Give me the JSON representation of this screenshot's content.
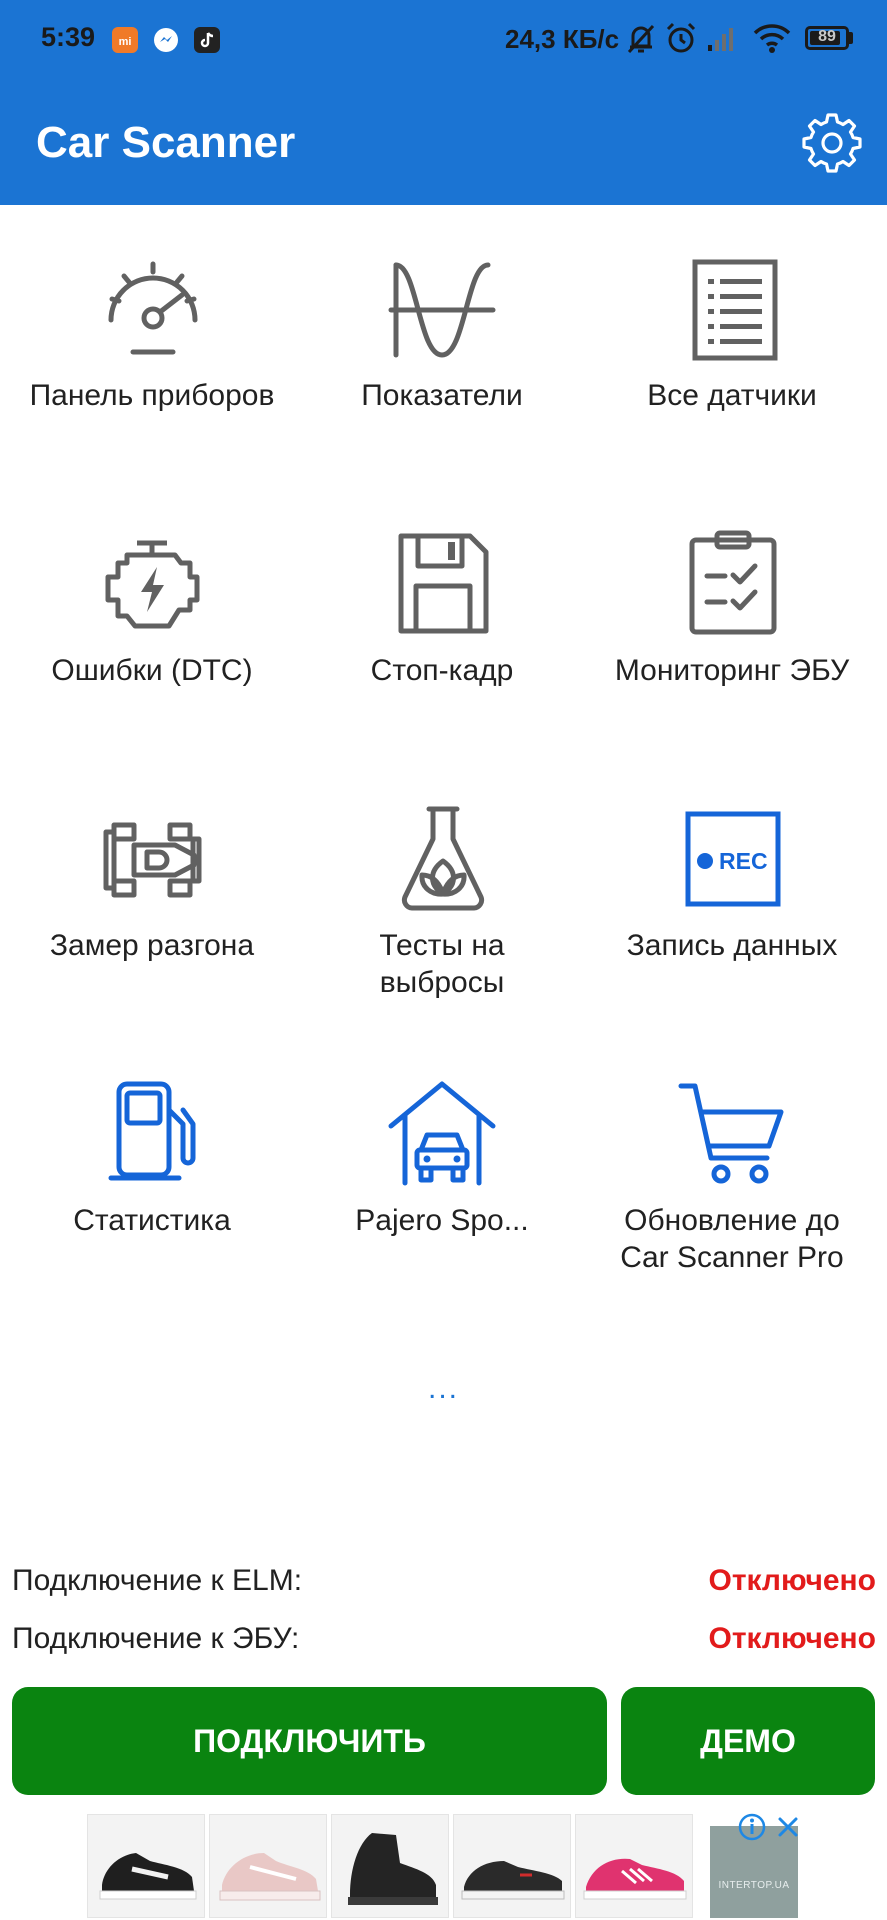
{
  "status_bar": {
    "time": "5:39",
    "network_speed": "24,3 КБ/с",
    "battery_level": "89",
    "battery_fraction": 0.89,
    "icons": [
      "mi-app-icon",
      "messenger-icon",
      "tiktok-icon",
      "mute-bell-icon",
      "alarm-icon",
      "signal-icon",
      "wifi-icon",
      "battery-icon"
    ]
  },
  "app_bar": {
    "title": "Car Scanner",
    "settings_icon": "gear-icon"
  },
  "menu": {
    "items": [
      {
        "label": "Панель приборов",
        "icon": "speedometer-icon",
        "color": "#616161"
      },
      {
        "label": "Показатели",
        "icon": "sine-wave-icon",
        "color": "#616161"
      },
      {
        "label": "Все датчики",
        "icon": "list-icon",
        "color": "#616161"
      },
      {
        "label": "Ошибки (DTC)",
        "icon": "engine-icon",
        "color": "#616161"
      },
      {
        "label": "Стоп-кадр",
        "icon": "floppy-disk-icon",
        "color": "#616161"
      },
      {
        "label": "Мониторинг ЭБУ",
        "icon": "clipboard-check-icon",
        "color": "#616161"
      },
      {
        "label": "Замер разгона",
        "icon": "race-car-icon",
        "color": "#616161"
      },
      {
        "label": "Тесты на\nвыбросы",
        "icon": "flask-leaf-icon",
        "color": "#616161"
      },
      {
        "label": "Запись данных",
        "icon": "rec-icon",
        "color": "#1565d8"
      },
      {
        "label": "Статистика",
        "icon": "fuel-pump-icon",
        "color": "#1565d8"
      },
      {
        "label": "Pajero Spo...",
        "icon": "garage-car-icon",
        "color": "#1565d8"
      },
      {
        "label": "Обновление до\nCar Scanner Pro",
        "icon": "cart-icon",
        "color": "#1565d8"
      }
    ],
    "more": "..."
  },
  "connection": {
    "elm_label": "Подключение к ELM:",
    "elm_value": "Отключено",
    "ecu_label": "Подключение к ЭБУ:",
    "ecu_value": "Отключено",
    "status_color": "#e21b1b"
  },
  "actions": {
    "connect_label": "ПОДКЛЮЧИТЬ",
    "demo_label": "ДЕМО",
    "button_color": "#0a8410"
  },
  "ad": {
    "brand": "INTERTOP.UA",
    "info_icon": "info-icon",
    "close_icon": "close-icon",
    "products": [
      "black-white-sneaker",
      "pink-sneaker",
      "black-boot",
      "black-canvas-shoe",
      "pink-running-shoe"
    ]
  },
  "colors": {
    "primary": "#1b74d3",
    "accent_blue": "#1565d8",
    "icon_gray": "#616161"
  }
}
